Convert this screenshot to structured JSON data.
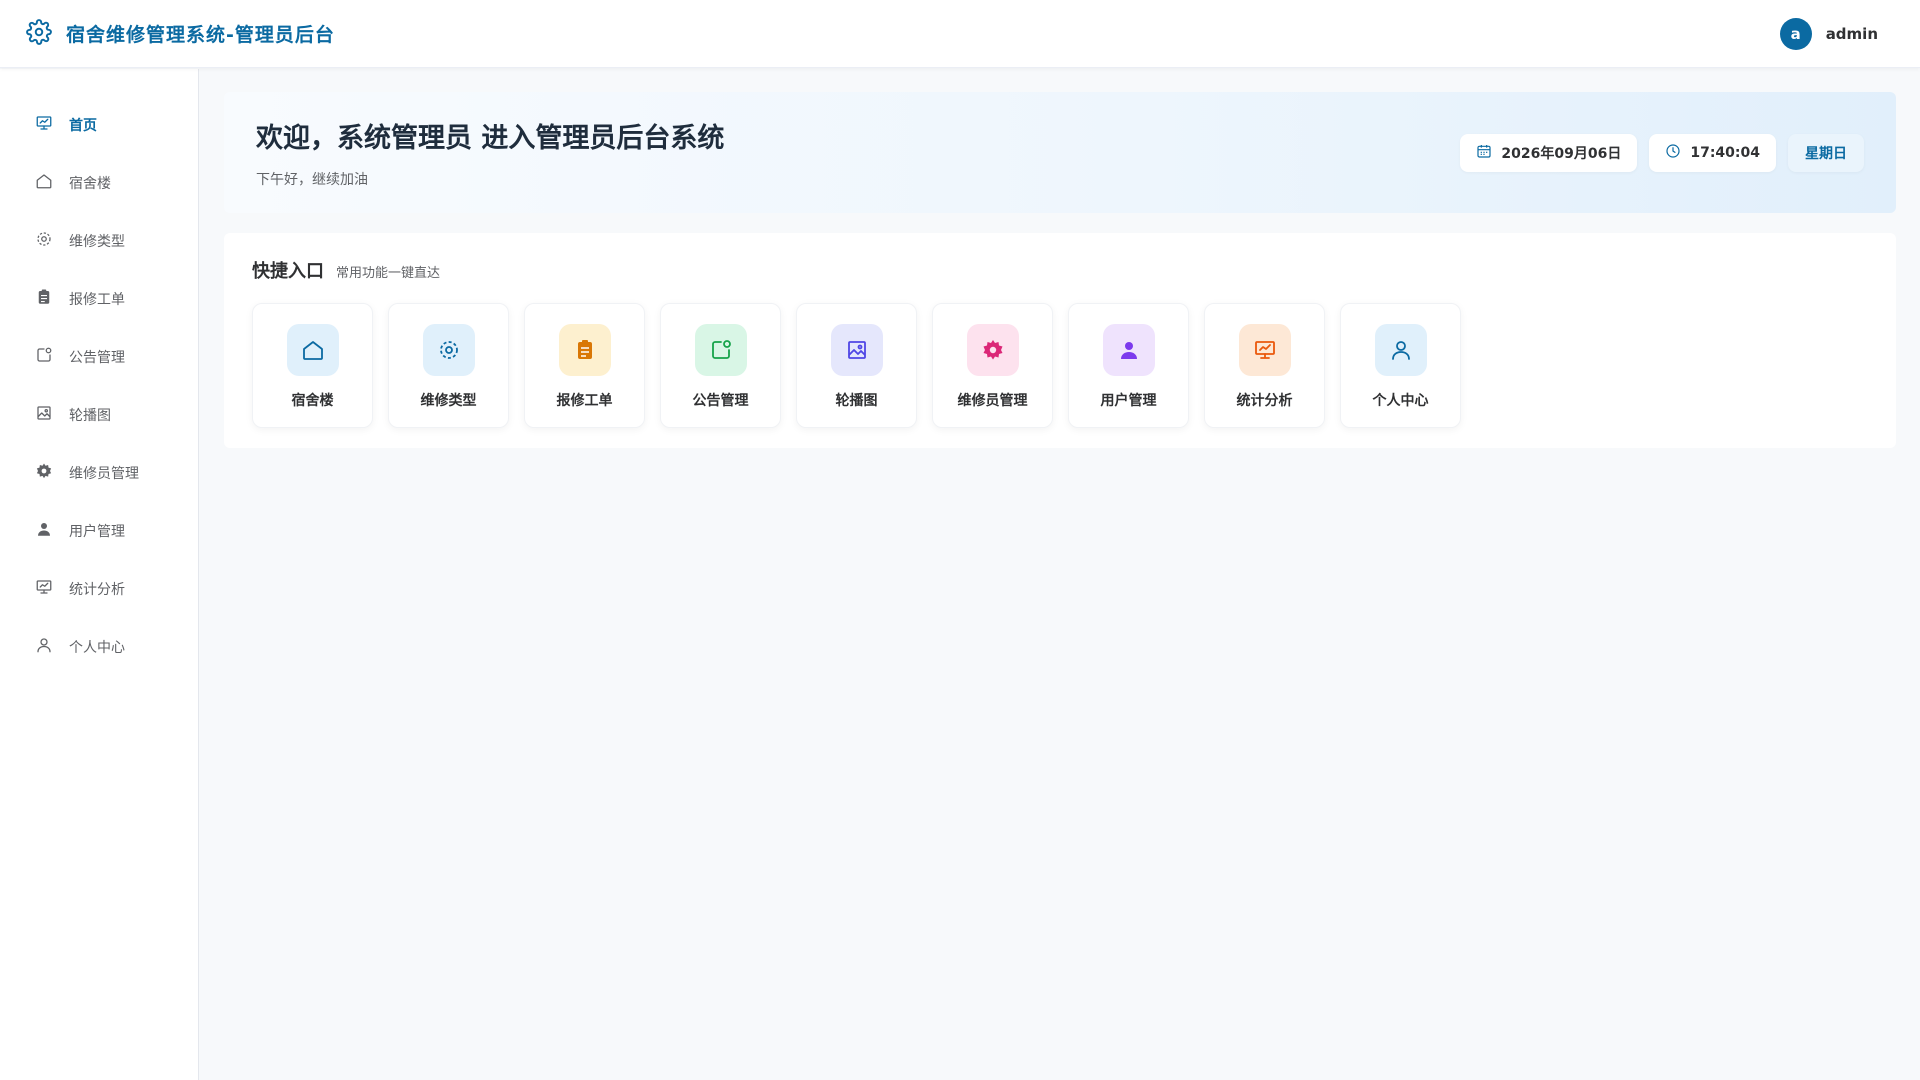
{
  "header": {
    "brand_icon": "gear-icon",
    "title": "宿舍维修管理系统-管理员后台",
    "avatar_letter": "a",
    "username": "admin"
  },
  "sidebar": {
    "items": [
      {
        "label": "首页",
        "icon": "presentation-icon",
        "active": true
      },
      {
        "label": "宿舍楼",
        "icon": "house-icon"
      },
      {
        "label": "维修类型",
        "icon": "gear-icon"
      },
      {
        "label": "报修工单",
        "icon": "clipboard-icon"
      },
      {
        "label": "公告管理",
        "icon": "notification-icon"
      },
      {
        "label": "轮播图",
        "icon": "picture-icon"
      },
      {
        "label": "维修员管理",
        "icon": "cog-filled-icon"
      },
      {
        "label": "用户管理",
        "icon": "user-filled-icon"
      },
      {
        "label": "统计分析",
        "icon": "presentation-icon"
      },
      {
        "label": "个人中心",
        "icon": "user-icon"
      }
    ]
  },
  "welcome": {
    "title": "欢迎，系统管理员 进入管理员后台系统",
    "subtitle": "下午好，继续加油",
    "date": "2026年09月06日",
    "time": "17:40:04",
    "weekday": "星期日"
  },
  "quick": {
    "title": "快捷入口",
    "subtitle": "常用功能一键直达",
    "cards": [
      {
        "label": "宿舍楼",
        "icon": "house-icon",
        "bg": "#e0f0fb",
        "color": "#0b6aa2"
      },
      {
        "label": "维修类型",
        "icon": "gear-icon",
        "bg": "#e0f0fb",
        "color": "#0b6aa2"
      },
      {
        "label": "报修工单",
        "icon": "clipboard-icon",
        "bg": "#fdf0cf",
        "color": "#d97706"
      },
      {
        "label": "公告管理",
        "icon": "notification-icon",
        "bg": "#d9f6e6",
        "color": "#16a34a"
      },
      {
        "label": "轮播图",
        "icon": "picture-icon",
        "bg": "#e5e7fc",
        "color": "#4f46e5"
      },
      {
        "label": "维修员管理",
        "icon": "cog-filled-icon",
        "bg": "#fde2ee",
        "color": "#db2777"
      },
      {
        "label": "用户管理",
        "icon": "user-filled-icon",
        "bg": "#efe3fd",
        "color": "#7c3aed"
      },
      {
        "label": "统计分析",
        "icon": "presentation-icon",
        "bg": "#fde8d6",
        "color": "#ea580c"
      },
      {
        "label": "个人中心",
        "icon": "user-icon",
        "bg": "#e0f0fb",
        "color": "#0b6aa2"
      }
    ]
  },
  "colors": {
    "accent": "#0b6aa2",
    "sidebar_icon": "#606266"
  }
}
